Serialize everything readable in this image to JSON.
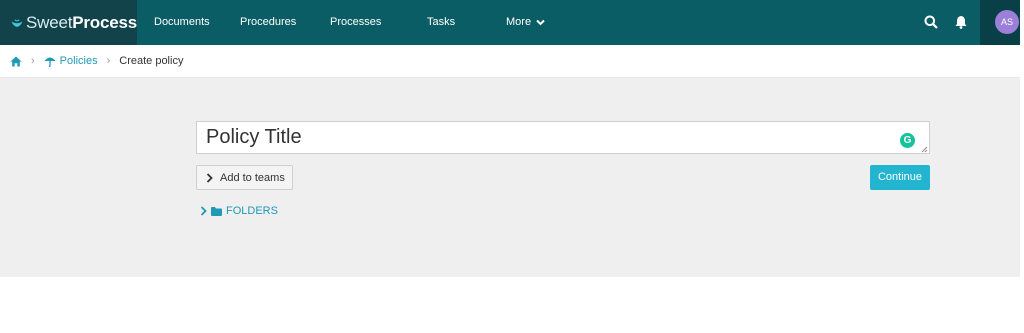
{
  "app": {
    "logo_text_light": "Sweet",
    "logo_text_bold": "Process",
    "accent": "#0b5d65",
    "link_color": "#1e9ab7"
  },
  "nav": {
    "items": [
      {
        "label": "Documents"
      },
      {
        "label": "Procedures"
      },
      {
        "label": "Processes"
      },
      {
        "label": "Tasks"
      },
      {
        "label": "More"
      }
    ],
    "more_icon": "chevron-down-icon",
    "search_icon": "search-icon",
    "bell_icon": "bell-icon",
    "avatar_initials": "AS"
  },
  "breadcrumb": {
    "home_icon": "home-icon",
    "policies_icon": "umbrella-icon",
    "policies_label": "Policies",
    "current_label": "Create policy"
  },
  "form": {
    "title_value": "Policy Title",
    "add_teams_label": "Add to teams",
    "continue_label": "Continue",
    "continue_color": "#23b5d0",
    "folders_label": "FOLDERS",
    "grammarly_glyph": "G"
  }
}
